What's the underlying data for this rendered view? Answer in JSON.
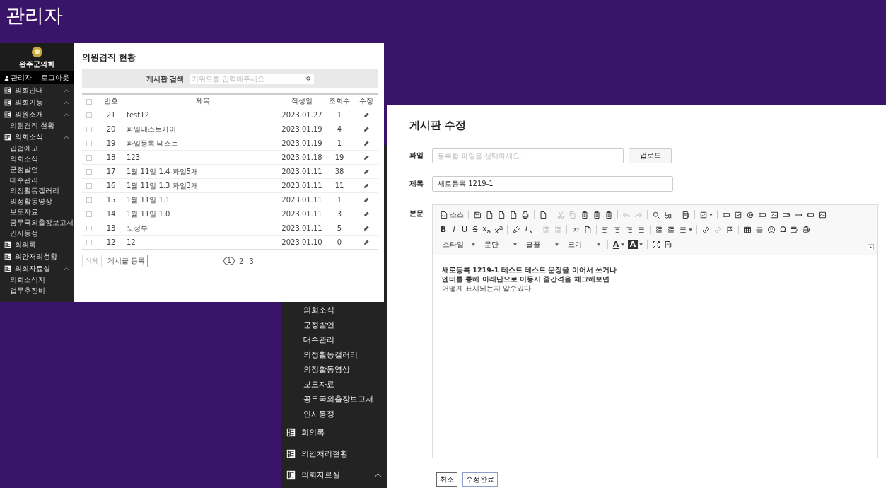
{
  "page_title": "관리자",
  "front": {
    "sidebar": {
      "logo_text": "완주군의회",
      "user": "관리자",
      "logout": "로그아웃",
      "groups": [
        {
          "label": "의회안내",
          "expanded": true
        },
        {
          "label": "의회기능",
          "expanded": true
        },
        {
          "label": "의원소개",
          "expanded": true,
          "children": [
            {
              "label": "의원겸직 현황"
            }
          ]
        },
        {
          "label": "의회소식",
          "expanded": true,
          "children": [
            {
              "label": "입법예고"
            },
            {
              "label": "의회소식"
            },
            {
              "label": "군정발언"
            },
            {
              "label": "대수관리"
            },
            {
              "label": "의정활동갤러리"
            },
            {
              "label": "의정활동영상"
            },
            {
              "label": "보도자료"
            },
            {
              "label": "공무국외출장보고서"
            },
            {
              "label": "인사동정"
            }
          ]
        },
        {
          "label": "회의록"
        },
        {
          "label": "의안처리현황"
        },
        {
          "label": "의회자료실",
          "expanded": true,
          "children": [
            {
              "label": "의회소식지"
            },
            {
              "label": "업무추진비"
            }
          ]
        }
      ]
    },
    "board": {
      "title": "의원겸직 현황",
      "search_label": "게시판 검색",
      "search": {
        "placeholder": "키워드를 입력해주세요."
      },
      "header_checked": false,
      "columns": [
        "번호",
        "제목",
        "작성일",
        "조회수",
        "수정"
      ],
      "rows": [
        {
          "no": "21",
          "title": "test12",
          "date": "2023.01.27",
          "views": "1",
          "checked": false
        },
        {
          "no": "20",
          "title": "파일테스트카이",
          "date": "2023.01.19",
          "views": "4",
          "checked": false
        },
        {
          "no": "19",
          "title": "파일등록 테스트",
          "date": "2023.01.19",
          "views": "1",
          "checked": false
        },
        {
          "no": "18",
          "title": "123",
          "date": "2023.01.18",
          "views": "19",
          "checked": false
        },
        {
          "no": "17",
          "title": "1월 11일 1.4 파일5개",
          "date": "2023.01.11",
          "views": "38",
          "checked": false
        },
        {
          "no": "16",
          "title": "1월 11일 1.3 파일3개",
          "date": "2023.01.11",
          "views": "11",
          "checked": false
        },
        {
          "no": "15",
          "title": "1월 11일 1.1",
          "date": "2023.01.11",
          "views": "1",
          "checked": false
        },
        {
          "no": "14",
          "title": "1월 11일 1.0",
          "date": "2023.01.11",
          "views": "3",
          "checked": false
        },
        {
          "no": "13",
          "title": "노정부",
          "date": "2023.01.11",
          "views": "5",
          "checked": false
        },
        {
          "no": "12",
          "title": "12",
          "date": "2023.01.10",
          "views": "0",
          "checked": false
        }
      ],
      "buttons": [
        {
          "label": "삭제",
          "kind": "plain"
        },
        {
          "label": "게시글 등록",
          "kind": "primary"
        }
      ],
      "pages": [
        {
          "label": "1",
          "selected": true
        },
        {
          "label": "2",
          "selected": false
        },
        {
          "label": "3",
          "selected": false
        }
      ]
    }
  },
  "back_sidebar": {
    "items": [
      {
        "label": "의회소식",
        "kind": "sub"
      },
      {
        "label": "군정발언",
        "kind": "sub"
      },
      {
        "label": "대수관리",
        "kind": "sub"
      },
      {
        "label": "의정활동갤러리",
        "kind": "sub"
      },
      {
        "label": "의정활동영상",
        "kind": "sub"
      },
      {
        "label": "보도자료",
        "kind": "sub"
      },
      {
        "label": "공무국외출장보고서",
        "kind": "sub"
      },
      {
        "label": "인사동정",
        "kind": "sub"
      },
      {
        "label": "회의록",
        "kind": "group"
      },
      {
        "label": "의안처리현황",
        "kind": "group"
      },
      {
        "label": "의회자료실",
        "kind": "group",
        "expanded": true
      }
    ]
  },
  "editor": {
    "title": "게시판 수정",
    "file_label": "파일",
    "file": {
      "placeholder": "등록할 파일을 선택하세요."
    },
    "upload_button": "업로드",
    "subject_label": "제목",
    "subject": {
      "value": "새로등록 1219-1"
    },
    "body_label": "본문",
    "toolbar": [
      [
        {
          "kind": "button",
          "label": "소스",
          "disabled": false
        },
        {
          "kind": "separator"
        },
        {
          "kind": "button",
          "disabled": false
        },
        {
          "kind": "button",
          "disabled": false
        },
        {
          "kind": "button",
          "disabled": false
        },
        {
          "kind": "button",
          "disabled": false
        },
        {
          "kind": "button",
          "disabled": false
        },
        {
          "kind": "separator"
        },
        {
          "kind": "button",
          "disabled": false
        },
        {
          "kind": "separator"
        },
        {
          "kind": "button",
          "disabled": true
        },
        {
          "kind": "button",
          "disabled": true
        },
        {
          "kind": "button",
          "disabled": false
        },
        {
          "kind": "button",
          "disabled": false
        },
        {
          "kind": "button",
          "disabled": false
        },
        {
          "kind": "separator"
        },
        {
          "kind": "button",
          "disabled": true
        },
        {
          "kind": "button",
          "disabled": true
        },
        {
          "kind": "separator"
        },
        {
          "kind": "button",
          "disabled": false
        },
        {
          "kind": "button",
          "disabled": false
        },
        {
          "kind": "separator"
        },
        {
          "kind": "button",
          "disabled": false
        },
        {
          "kind": "separator"
        },
        {
          "kind": "button",
          "disabled": false,
          "menu": true
        },
        {
          "kind": "separator"
        },
        {
          "kind": "button",
          "disabled": false
        },
        {
          "kind": "button",
          "disabled": false
        },
        {
          "kind": "button",
          "disabled": false
        },
        {
          "kind": "button",
          "disabled": false
        },
        {
          "kind": "button",
          "disabled": false
        },
        {
          "kind": "button",
          "disabled": false
        },
        {
          "kind": "button",
          "disabled": false
        },
        {
          "kind": "button",
          "disabled": false
        },
        {
          "kind": "button",
          "disabled": false
        }
      ],
      [
        {
          "kind": "bold",
          "label": "B"
        },
        {
          "kind": "italic",
          "label": "I"
        },
        {
          "kind": "underline",
          "label": "U"
        },
        {
          "kind": "strike",
          "label": "S"
        },
        {
          "kind": "plain",
          "label": "x$_{a}$"
        },
        {
          "kind": "plain",
          "label": "x$^{a}$"
        },
        {
          "kind": "separator"
        },
        {
          "kind": "button",
          "disabled": false
        },
        {
          "kind": "italic",
          "label": "T$_{x}$"
        },
        {
          "kind": "separator"
        },
        {
          "kind": "button",
          "disabled": true
        },
        {
          "kind": "button",
          "disabled": true
        },
        {
          "kind": "separator"
        },
        {
          "kind": "button",
          "disabled": false
        },
        {
          "kind": "button",
          "disabled": false
        },
        {
          "kind": "separator"
        },
        {
          "kind": "button",
          "disabled": false
        },
        {
          "kind": "button",
          "disabled": false
        },
        {
          "kind": "button",
          "disabled": false
        },
        {
          "kind": "button",
          "disabled": false
        },
        {
          "kind": "separator"
        },
        {
          "kind": "button",
          "disabled": false
        },
        {
          "kind": "button",
          "disabled": false
        },
        {
          "kind": "button",
          "disabled": false,
          "menu": true
        },
        {
          "kind": "separator"
        },
        {
          "kind": "button",
          "disabled": false
        },
        {
          "kind": "button",
          "disabled": true
        },
        {
          "kind": "button",
          "disabled": false
        },
        {
          "kind": "separator"
        },
        {
          "kind": "button",
          "disabled": false
        },
        {
          "kind": "button",
          "disabled": false
        },
        {
          "kind": "button",
          "disabled": false
        },
        {
          "kind": "plain",
          "label": "Ω"
        },
        {
          "kind": "button",
          "disabled": false
        },
        {
          "kind": "button",
          "disabled": false
        }
      ],
      [
        {
          "kind": "dropdown",
          "label": "스타일"
        },
        {
          "kind": "dropdown",
          "label": "문단"
        },
        {
          "kind": "dropdown",
          "label": "글꼴"
        },
        {
          "kind": "dropdown",
          "label": "크기"
        },
        {
          "kind": "separator"
        },
        {
          "kind": "color",
          "label": "A",
          "menu": true
        },
        {
          "kind": "background",
          "label": "A",
          "menu": true
        },
        {
          "kind": "separator"
        },
        {
          "kind": "button",
          "disabled": false
        },
        {
          "kind": "button",
          "disabled": false
        }
      ]
    ],
    "content": [
      {
        "text": "새로등록 1219-1 테스트 테스트 문장을 이어서 쓰거나",
        "bold": true
      },
      {
        "text": "엔터를 통해 아래단으로 이동시 줄간격을 체크해보면",
        "bold": true
      },
      {
        "text": "어떻게 표시되는지 알수있다",
        "bold": false
      }
    ],
    "buttons": [
      {
        "label": "취소",
        "kind": "plain"
      },
      {
        "label": "수정완료",
        "kind": "primary"
      }
    ]
  }
}
